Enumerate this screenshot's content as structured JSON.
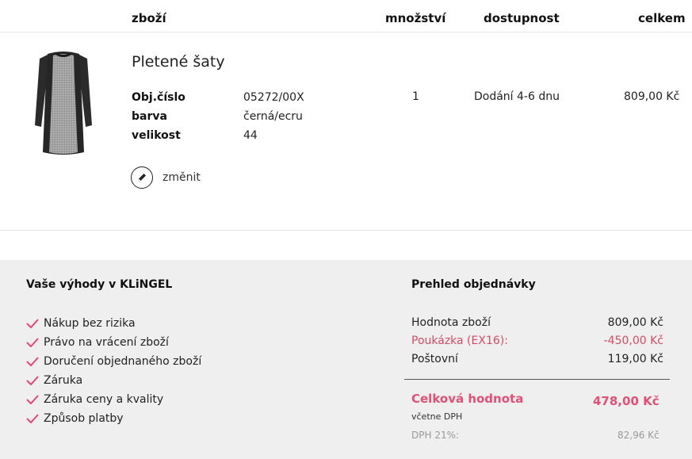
{
  "headers": {
    "item": "zboží",
    "quantity": "množství",
    "availability": "dostupnost",
    "total": "celkem"
  },
  "product": {
    "name": "Pletené šaty",
    "fields": [
      {
        "label": "Obj.číslo",
        "value": "05272/00X"
      },
      {
        "label": "barva",
        "value": "černá/ecru"
      },
      {
        "label": "velikost",
        "value": "44"
      }
    ],
    "change_label": "změnit",
    "quantity": "1",
    "availability": "Dodání 4-6 dnu",
    "total": "809,00 Kč"
  },
  "benefits": {
    "title": "Vaše výhody v KLiNGEL",
    "items": [
      "Nákup bez rizika",
      "Právo na vrácení zboží",
      "Doručení objednaného zboží",
      "Záruka",
      "Záruka ceny a kvality",
      "Způsob platby"
    ]
  },
  "summary": {
    "title": "Prehled objednávky",
    "goods_label": "Hodnota zboží",
    "goods_value": "809,00 Kč",
    "voucher_label": "Poukázka (EX16):",
    "voucher_value": "-450,00 Kč",
    "postage_label": "Poštovní",
    "postage_value": "119,00 Kč",
    "total_label": "Celková hodnota",
    "total_value": "478,00 Kč",
    "vat_note": "včetne DPH",
    "vat_label": "DPH 21%:",
    "vat_value": "82,96 Kč"
  },
  "colors": {
    "accent": "#e24f79",
    "check": "#e8457a",
    "panel_bg": "#efefef"
  }
}
